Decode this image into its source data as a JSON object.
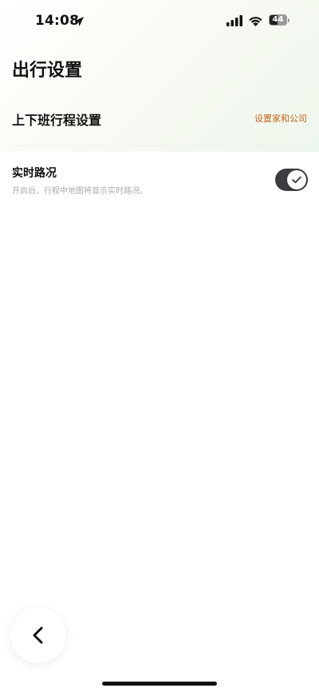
{
  "status_bar": {
    "time": "14:08",
    "battery_level": "44",
    "icons": [
      "location-arrow-icon",
      "cellular-signal-icon",
      "wifi-icon",
      "battery-icon"
    ]
  },
  "page": {
    "title": "出行设置"
  },
  "commute": {
    "label": "上下班行程设置",
    "action": "设置家和公司",
    "action_color": "#c8641c"
  },
  "traffic": {
    "label": "实时路况",
    "description": "开启后，行程中地图将显示实时路况。",
    "toggle_on": true,
    "toggle_color": "#3a3c40"
  },
  "navigation": {
    "back_icon": "chevron-left-icon"
  }
}
